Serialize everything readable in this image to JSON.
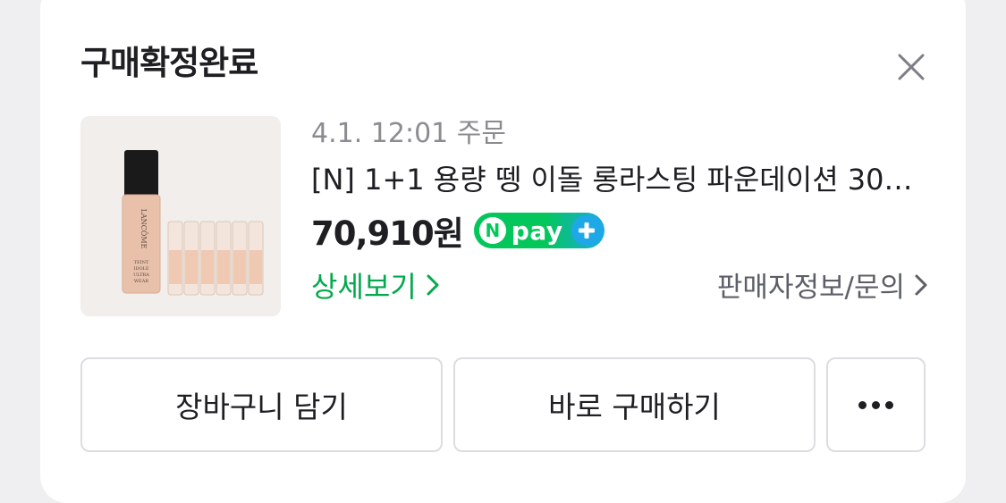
{
  "header": {
    "title": "구매확정완료",
    "close_icon": "close-icon"
  },
  "order": {
    "date": "4.1. 12:01 주문",
    "product_name": "[N] 1+1 용량 뗑 이돌 롱라스팅 파운데이션 30ml...",
    "price": "70,910원",
    "npay": {
      "n": "N",
      "label": "pay",
      "plus_icon": "plus-icon"
    },
    "detail_link": "상세보기",
    "seller_link": "판매자정보/문의",
    "thumbnail": {
      "brand": "LANCÔME",
      "lines": [
        "TEINT",
        "IDOLE",
        "ULTRA",
        "WEAR"
      ]
    }
  },
  "actions": {
    "cart_label": "장바구니 담기",
    "buy_label": "바로 구매하기",
    "more_icon": "more-dots-icon"
  },
  "colors": {
    "accent_green": "#03a94d",
    "npay_green": "#03c75a",
    "npay_blue": "#1fa8e8",
    "text": "#1e1e23",
    "muted": "#8a8c91"
  }
}
